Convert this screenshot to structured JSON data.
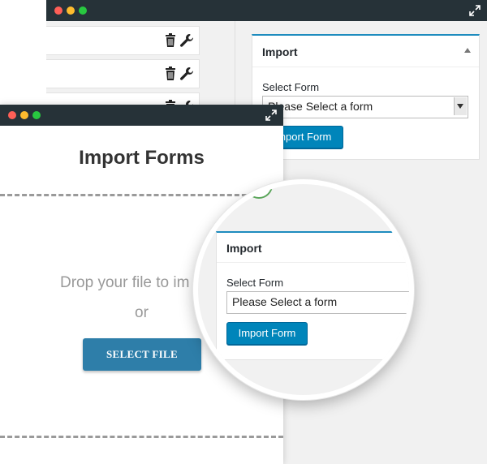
{
  "back_window": {
    "import_panel": {
      "title": "Import",
      "select_label": "Select Form",
      "select_value": "Please Select a form",
      "button_label": "Import Form"
    }
  },
  "front_window": {
    "title": "Import Forms",
    "drop_text": "Drop your file to im",
    "or_text": "or",
    "select_file_label": "SELECT FILE"
  },
  "magnifier": {
    "panel_title": "Import",
    "select_label": "Select Form",
    "select_value": "Please Select a form",
    "button_label": "Import Form"
  },
  "colors": {
    "titlebar": "#263238",
    "accent": "#0085ba",
    "select_file_button": "#2e7ea9"
  }
}
